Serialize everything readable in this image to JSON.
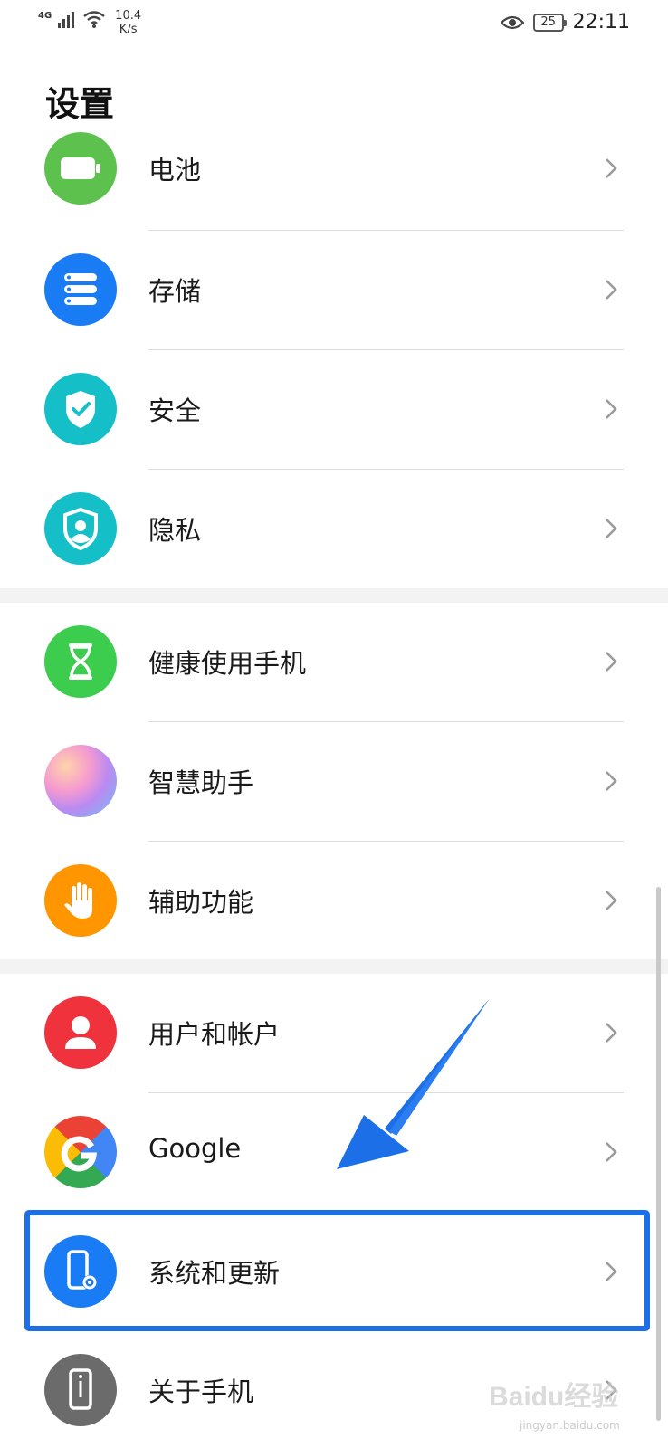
{
  "status_bar": {
    "network": "4G",
    "speed_value": "10.4",
    "speed_unit": "K/s",
    "battery": "25",
    "time": "22:11"
  },
  "title": "设置",
  "items": [
    {
      "label": "电池",
      "icon": "battery-icon",
      "color": "#5cc24d"
    },
    {
      "label": "存储",
      "icon": "storage-icon",
      "color": "#1a7cf5"
    },
    {
      "label": "安全",
      "icon": "security-shield-icon",
      "color": "#14bfc8"
    },
    {
      "label": "隐私",
      "icon": "privacy-icon",
      "color": "#14bfc8"
    },
    {
      "label": "健康使用手机",
      "icon": "hourglass-icon",
      "color": "#3dcd4e"
    },
    {
      "label": "智慧助手",
      "icon": "assistant-icon",
      "color": "#c98cf0"
    },
    {
      "label": "辅助功能",
      "icon": "hand-icon",
      "color": "#ff9600"
    },
    {
      "label": "用户和帐户",
      "icon": "user-icon",
      "color": "#f0323c"
    },
    {
      "label": "Google",
      "icon": "google-icon",
      "color": "#4285f4"
    },
    {
      "label": "系统和更新",
      "icon": "system-update-icon",
      "color": "#1a7cf5"
    },
    {
      "label": "关于手机",
      "icon": "phone-info-icon",
      "color": "#6b6b6b"
    }
  ],
  "highlight_color": "#1d6fe8",
  "watermark": {
    "main": "Baidu经验",
    "sub": "jingyan.baidu.com"
  }
}
